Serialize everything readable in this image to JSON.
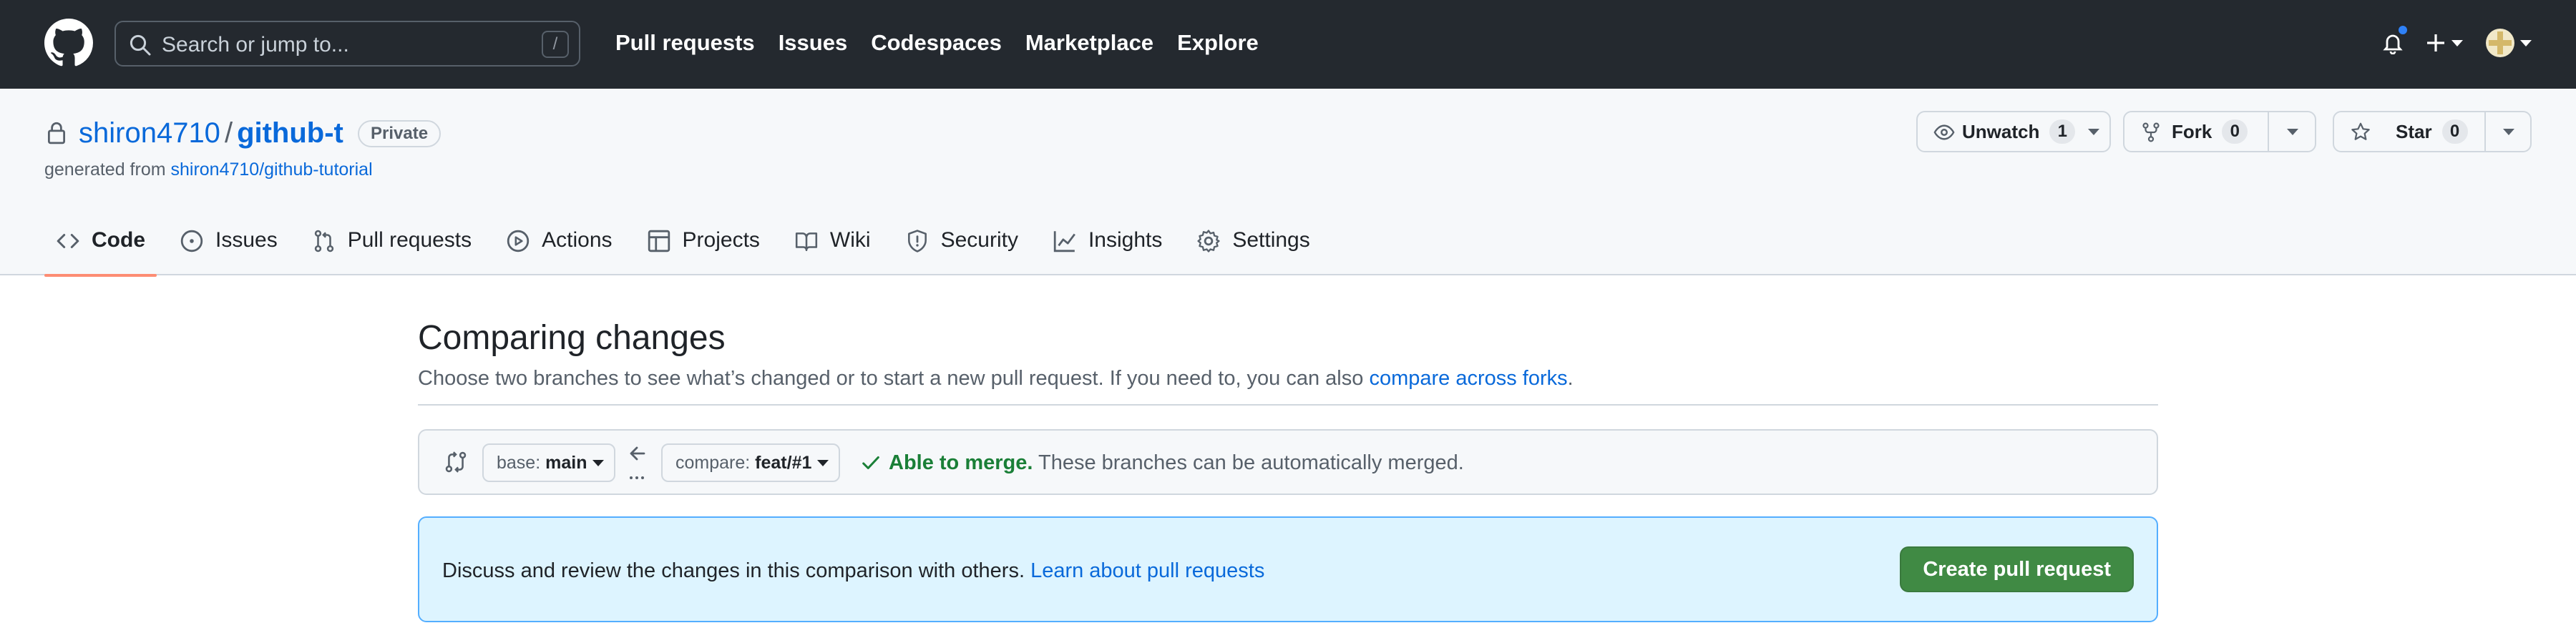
{
  "header": {
    "search_placeholder": "Search or jump to...",
    "search_shortcut": "/",
    "nav": [
      "Pull requests",
      "Issues",
      "Codespaces",
      "Marketplace",
      "Explore"
    ],
    "notification_dot_color": "#2f81f7"
  },
  "repo": {
    "owner": "shiron4710",
    "separator": "/",
    "name": "github-t",
    "visibility": "Private",
    "generated_prefix": "generated from",
    "generated_link": "shiron4710/github-tutorial",
    "unwatch_label": "Unwatch",
    "watch_count": "1",
    "fork_label": "Fork",
    "fork_count": "0",
    "star_label": "Star",
    "star_count": "0"
  },
  "tabs": [
    {
      "label": "Code",
      "icon": "code-icon",
      "active": true
    },
    {
      "label": "Issues",
      "icon": "issue-opened-icon"
    },
    {
      "label": "Pull requests",
      "icon": "git-pull-request-icon"
    },
    {
      "label": "Actions",
      "icon": "play-icon"
    },
    {
      "label": "Projects",
      "icon": "table-icon"
    },
    {
      "label": "Wiki",
      "icon": "book-icon"
    },
    {
      "label": "Security",
      "icon": "shield-icon"
    },
    {
      "label": "Insights",
      "icon": "graph-icon"
    },
    {
      "label": "Settings",
      "icon": "gear-icon"
    }
  ],
  "compare": {
    "title": "Comparing changes",
    "subtitle": "Choose two branches to see what’s changed or to start a new pull request. If you need to, you can also ",
    "subtitle_link": "compare across forks",
    "subtitle_end": ".",
    "base_prefix": "base: ",
    "base_branch": "main",
    "compare_prefix": "compare: ",
    "compare_branch": "feat/#1",
    "merge_status": "Able to merge.",
    "merge_detail": "These branches can be automatically merged.",
    "flash_text": "Discuss and review the changes in this comparison with others. ",
    "flash_link": "Learn about pull requests",
    "create_button": "Create pull request"
  },
  "colors": {
    "header_bg": "#24292f",
    "link": "#0969da",
    "success": "#1a7f37",
    "primary_button": "#408a44",
    "active_tab_underline": "#fd8c73",
    "flash_bg": "#ddf4ff"
  }
}
